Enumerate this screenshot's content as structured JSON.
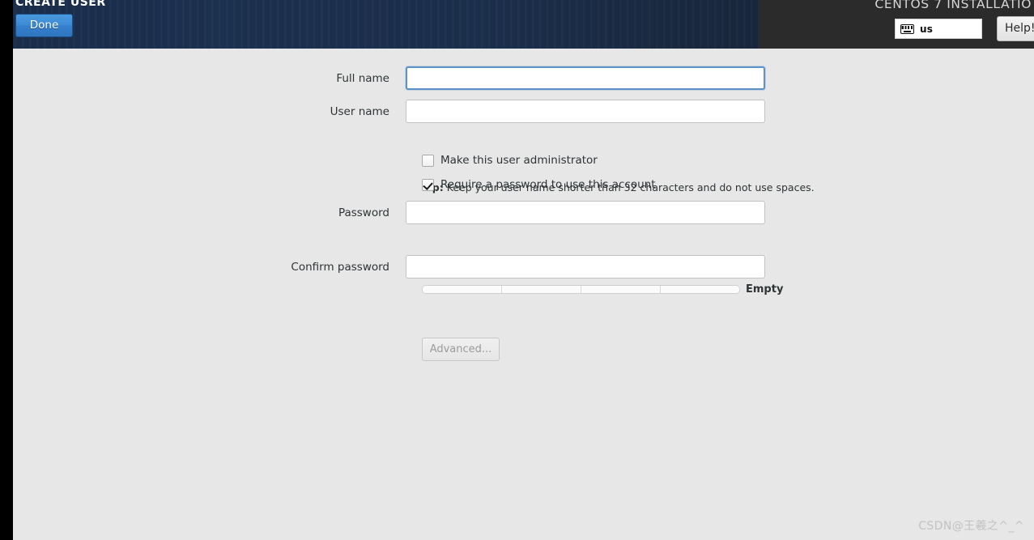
{
  "header": {
    "page_title": "CREATE USER",
    "product_title": "CENTOS 7 INSTALLATIO",
    "done_label": "Done",
    "help_label": "Help!",
    "keyboard_layout": "us",
    "keyboard_icon": "keyboard-icon"
  },
  "form": {
    "full_name": {
      "label": "Full name",
      "value": "",
      "placeholder": ""
    },
    "user_name": {
      "label": "User name",
      "value": "",
      "placeholder": ""
    },
    "tip_prefix": "Tip:",
    "tip_text": " Keep your user name shorter than 32 characters and do not use spaces.",
    "admin_checkbox": {
      "label": "Make this user administrator",
      "checked": false
    },
    "require_password_checkbox": {
      "label": "Require a password to use this account",
      "checked": true
    },
    "password": {
      "label": "Password",
      "value": "",
      "placeholder": ""
    },
    "strength": {
      "label": "Empty",
      "segments": 4,
      "filled": 0
    },
    "confirm_password": {
      "label": "Confirm password",
      "value": "",
      "placeholder": ""
    },
    "advanced_label": "Advanced..."
  },
  "watermark": "CSDN@王羲之^_^",
  "colors": {
    "header_navy": "#1c2f4c",
    "header_dark_panel": "#2b2b2b",
    "done_blue": "#3580cc",
    "body_grey": "#e7e7e7",
    "focus_blue": "#5c92c7"
  }
}
